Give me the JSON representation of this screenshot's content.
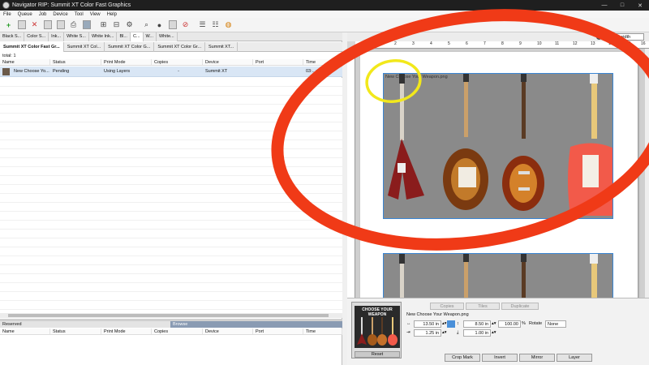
{
  "window": {
    "title": "Navigator RIP: Summit XT Color Fast Graphics",
    "minimize": "—",
    "maximize": "□"
  },
  "menu": [
    "File",
    "Queue",
    "Job",
    "Device",
    "Tool",
    "View",
    "Help"
  ],
  "queue_tabs": [
    "Black S...",
    "Color S...",
    "Ink...",
    "White S...",
    "White Ink...",
    "Bl...",
    "C...",
    "W...",
    "White..."
  ],
  "active_queue_tab": 6,
  "sub_tabs": [
    "Summit XT Color Fast Gr...",
    "Summit XT Col...",
    "Summit XT Color G...",
    "Summit XT Color Gr...",
    "Summit XT..."
  ],
  "total_label": "total: 1",
  "columns": [
    "Name",
    "Status",
    "Print Mode",
    "Copies",
    "Device",
    "Port",
    "Time"
  ],
  "job_row": {
    "name": "New Choose Yo...",
    "status": "Pending",
    "print_mode": "Using Layers",
    "copies": "-",
    "device": "Summit XT",
    "port": "",
    "time": "03:...:00:42"
  },
  "bottom_tabs": {
    "reserved": "Reserved",
    "browse": "Browse"
  },
  "zoom": "To width",
  "ruler_ticks": [
    "2",
    "3",
    "4",
    "5",
    "6",
    "7",
    "8",
    "9",
    "10",
    "11",
    "12",
    "13",
    "14",
    "15",
    "16"
  ],
  "canvas_image_label": "New Choose Your Weapon.png",
  "preview": {
    "text": "CHOOSE YOUR WEAPON",
    "reset": "Reset"
  },
  "panel_tabs": [
    "Copies",
    "Tiles",
    "Duplicate"
  ],
  "props": {
    "filename": "New Choose Your Weapon.png",
    "width": "13.50 in",
    "height": "8.50 in",
    "scale": "100.00",
    "scale_unit": "%",
    "rotate_label": "Rotate",
    "rotate_value": "None",
    "x_offset": "1.25 in",
    "y_offset": "1.00 in"
  },
  "action_buttons": [
    "Crop Mark",
    "Invert",
    "Mirror",
    "Layer"
  ],
  "colors": {
    "annotation_red": "#f03a17",
    "annotation_yellow": "#f2e81b",
    "selection_blue": "#3a86d4"
  }
}
